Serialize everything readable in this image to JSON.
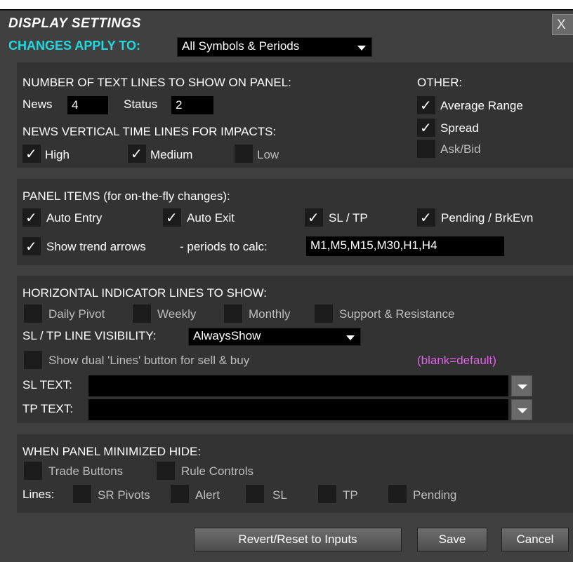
{
  "dialog": {
    "title": "DISPLAY SETTINGS",
    "close_label": "X",
    "apply_label": "CHANGES APPLY TO:",
    "apply_value": "All Symbols & Periods"
  },
  "text_lines": {
    "heading": "NUMBER OF TEXT LINES TO SHOW ON PANEL:",
    "news_label": "News",
    "news_value": "4",
    "status_label": "Status",
    "status_value": "2",
    "news_lines_heading": "NEWS VERTICAL TIME LINES FOR IMPACTS:",
    "high": {
      "label": "High",
      "checked": true
    },
    "medium": {
      "label": "Medium",
      "checked": true
    },
    "low": {
      "label": "Low",
      "checked": false
    }
  },
  "other": {
    "heading": "OTHER:",
    "average_range": {
      "label": "Average Range",
      "checked": true
    },
    "spread": {
      "label": "Spread",
      "checked": true
    },
    "ask_bid": {
      "label": "Ask/Bid",
      "checked": false
    }
  },
  "panel_items": {
    "heading": "PANEL ITEMS (for on-the-fly changes):",
    "auto_entry": {
      "label": "Auto Entry",
      "checked": true
    },
    "auto_exit": {
      "label": "Auto Exit",
      "checked": true
    },
    "sl_tp": {
      "label": "SL / TP",
      "checked": true
    },
    "pending": {
      "label": "Pending / BrkEvn",
      "checked": true
    },
    "trend_arrows": {
      "label": "Show trend arrows",
      "checked": true
    },
    "periods_label": "- periods to calc:",
    "periods_value": "M1,M5,M15,M30,H1,H4"
  },
  "horizontal": {
    "heading": "HORIZONTAL INDICATOR LINES TO SHOW:",
    "daily_pivot": {
      "label": "Daily Pivot",
      "checked": false
    },
    "weekly": {
      "label": "Weekly",
      "checked": false
    },
    "monthly": {
      "label": "Monthly",
      "checked": false
    },
    "support_resistance": {
      "label": "Support & Resistance",
      "checked": false
    },
    "visibility_label": "SL / TP LINE VISIBILITY:",
    "visibility_value": "AlwaysShow",
    "dual_lines": {
      "label": "Show dual 'Lines' button for sell & buy",
      "checked": false
    },
    "blank_hint": "(blank=default)",
    "sl_text_label": "SL TEXT:",
    "sl_text_value": "",
    "tp_text_label": "TP TEXT:",
    "tp_text_value": ""
  },
  "minimized": {
    "heading": "WHEN PANEL MINIMIZED HIDE:",
    "trade_buttons": {
      "label": "Trade Buttons",
      "checked": false
    },
    "rule_controls": {
      "label": "Rule Controls",
      "checked": false
    },
    "lines_label": "Lines:",
    "sr_pivots": {
      "label": "SR Pivots",
      "checked": false
    },
    "alert": {
      "label": "Alert",
      "checked": false
    },
    "sl": {
      "label": "SL",
      "checked": false
    },
    "tp": {
      "label": "TP",
      "checked": false
    },
    "pending": {
      "label": "Pending",
      "checked": false
    }
  },
  "footer": {
    "revert_label": "Revert/Reset to Inputs",
    "save_label": "Save",
    "cancel_label": "Cancel"
  },
  "colors": {
    "background": "#404040",
    "panel": "#333333",
    "accent": "#22d8e0",
    "hint": "#e060e8"
  }
}
